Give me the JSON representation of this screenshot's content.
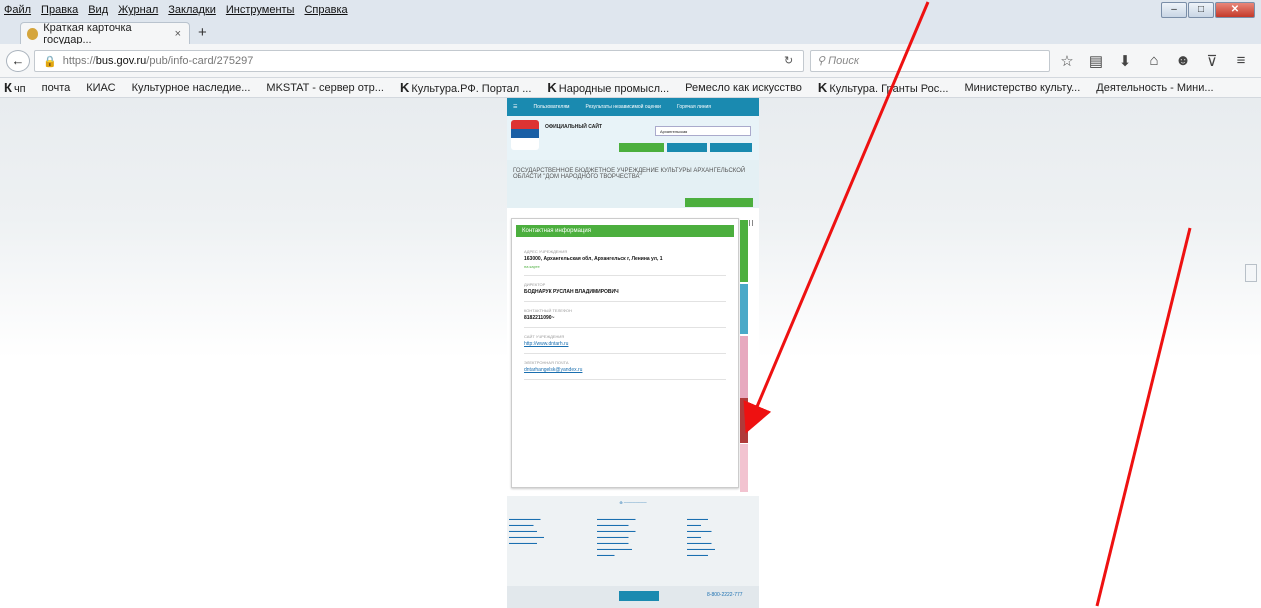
{
  "menu": [
    "Файл",
    "Правка",
    "Вид",
    "Журнал",
    "Закладки",
    "Инструменты",
    "Справка"
  ],
  "tab": {
    "title": "Краткая карточка государ...",
    "close": "×",
    "new": "+"
  },
  "nav": {
    "url_prefix": "https://",
    "url_host": "bus.gov.ru",
    "url_path": "/pub/info-card/275297",
    "search_placeholder": "Поиск"
  },
  "bookmarks": [
    {
      "icon": "К",
      "label": "чп"
    },
    {
      "icon": "",
      "label": "почта"
    },
    {
      "icon": "",
      "label": "КИАС"
    },
    {
      "icon": "",
      "label": "Культурное наследие..."
    },
    {
      "icon": "",
      "label": "MKSTAT - сервер отр..."
    },
    {
      "icon": "K",
      "label": "Культура.РФ. Портал ..."
    },
    {
      "icon": "K",
      "label": "Народные промысл..."
    },
    {
      "icon": "",
      "label": "Ремесло как искусство"
    },
    {
      "icon": "K",
      "label": "Культура. Гранты Рос..."
    },
    {
      "icon": "",
      "label": "Министерство культу..."
    },
    {
      "icon": "",
      "label": "Деятельность - Мини..."
    }
  ],
  "site": {
    "header_items": [
      "Пользователям",
      "Результаты независимой оценки",
      "Горячая линия"
    ],
    "official": "ОФИЦИАЛЬНЫЙ САЙТ",
    "region": "Архангельская",
    "org_name": "ГОСУДАРСТВЕННОЕ БЮДЖЕТНОЕ УЧРЕЖДЕНИЕ КУЛЬТУРЫ АРХАНГЕЛЬСКОЙ ОБЛАСТИ \"ДОМ НАРОДНОГО ТВОРЧЕСТВА\"",
    "card_title": "Контактная информация",
    "address_label": "АДРЕС УЧРЕЖДЕНИЯ",
    "address": "163000, Архангельская обл, Архангельск г, Ленина ул, 1",
    "map_link": "на карте",
    "director_label": "ДИРЕКТОР",
    "director": "БОДНАРУК РУСЛАН ВЛАДИМИРОВИЧ",
    "phone_label": "КОНТАКТНЫЙ ТЕЛЕФОН",
    "phone": "8182211090~",
    "site_label": "САЙТ УЧРЕЖДЕНИЯ",
    "site_url": "http://www.dntarh.ru",
    "email_label": "ЭЛЕКТРОННАЯ ПОЧТА",
    "email": "dntarhangelsk@yandex.ru",
    "footer_phone": "8-800-2222-777"
  },
  "colors": {
    "green": "#4caf3e",
    "teal": "#1a8ab0",
    "pink": "#e7a9bf",
    "red": "#b03a3a",
    "annotation": "#ee1111"
  }
}
